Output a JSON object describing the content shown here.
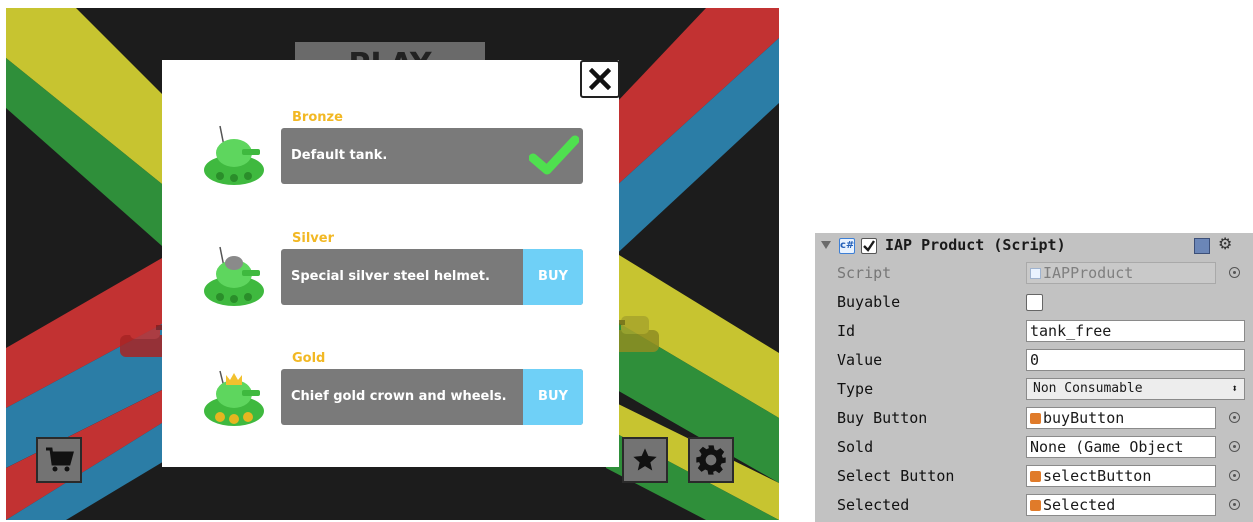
{
  "game": {
    "play_label": "PLAY",
    "dialog": {
      "close_symbol": "✕",
      "products": [
        {
          "tier": "Bronze",
          "description": "Default tank.",
          "state": "selected",
          "buy_label": ""
        },
        {
          "tier": "Silver",
          "description": "Special silver steel helmet.",
          "state": "buy",
          "buy_label": "BUY"
        },
        {
          "tier": "Gold",
          "description": "Chief gold crown and wheels.",
          "state": "buy",
          "buy_label": "BUY"
        }
      ]
    },
    "stripe_colors": {
      "yellow": "#c7c430",
      "green": "#2f8f3a",
      "red": "#c23232",
      "blue": "#2b7da6"
    },
    "buttons": {
      "shop": "cart-icon",
      "rate": "star-icon",
      "settings": "gear-icon"
    }
  },
  "inspector": {
    "component_title": "IAP Product (Script)",
    "component_enabled": true,
    "properties": {
      "script": {
        "label": "Script",
        "value": "IAPProduct"
      },
      "buyable": {
        "label": "Buyable",
        "checked": false
      },
      "id": {
        "label": "Id",
        "value": "tank_free"
      },
      "value": {
        "label": "Value",
        "value": "0"
      },
      "type": {
        "label": "Type",
        "value": "Non Consumable"
      },
      "buy_button": {
        "label": "Buy Button",
        "value": "buyButton"
      },
      "sold": {
        "label": "Sold",
        "value": "None (Game Object"
      },
      "select_button": {
        "label": "Select Button",
        "value": "selectButton"
      },
      "selected": {
        "label": "Selected",
        "value": "Selected"
      }
    }
  }
}
